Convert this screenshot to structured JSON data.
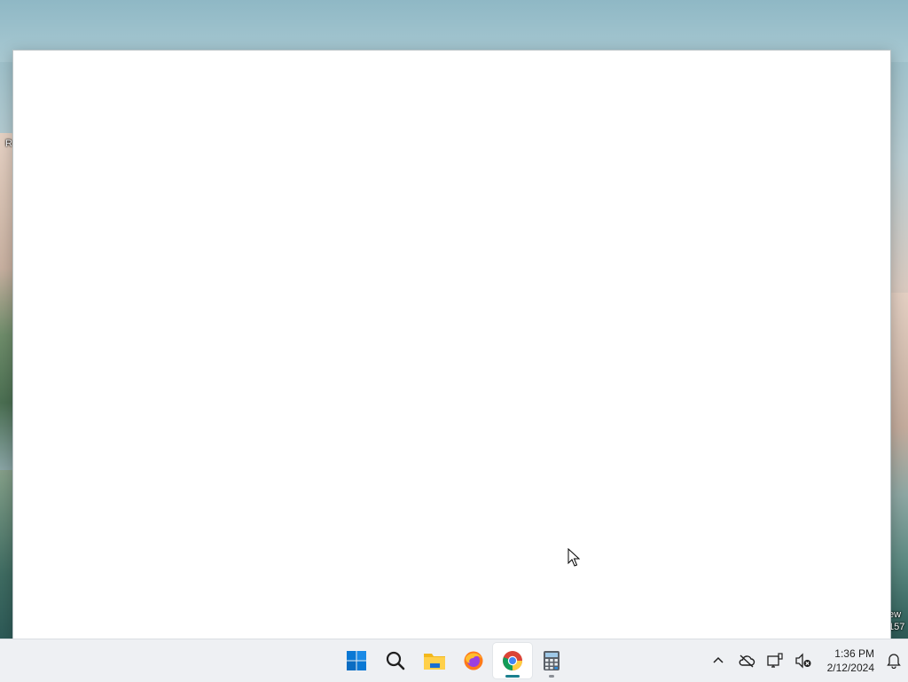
{
  "desktop": {
    "left_icon_label_fragment": "R",
    "right_icon_label_line1": "ew",
    "right_icon_label_line2": "157"
  },
  "window": {
    "state": "blank"
  },
  "taskbar": {
    "apps": [
      {
        "name": "Start",
        "icon": "windows-logo-icon",
        "active": false
      },
      {
        "name": "Search",
        "icon": "search-icon",
        "active": false
      },
      {
        "name": "File Explorer",
        "icon": "folder-icon",
        "active": false
      },
      {
        "name": "Firefox",
        "icon": "firefox-icon",
        "active": false
      },
      {
        "name": "Chrome",
        "icon": "chrome-icon",
        "active": true
      },
      {
        "name": "Calculator",
        "icon": "calculator-icon",
        "active": false,
        "running": true
      }
    ],
    "tray": {
      "icons": [
        "chevron-up-icon",
        "cloud-offline-icon",
        "network-icon",
        "volume-muted-icon"
      ],
      "time": "1:36 PM",
      "date": "2/12/2024",
      "notification_icon": "bell-icon"
    }
  },
  "colors": {
    "taskbar_bg": "#eef0f3",
    "active_indicator": "#1a7f8e",
    "window_bg": "#ffffff"
  }
}
